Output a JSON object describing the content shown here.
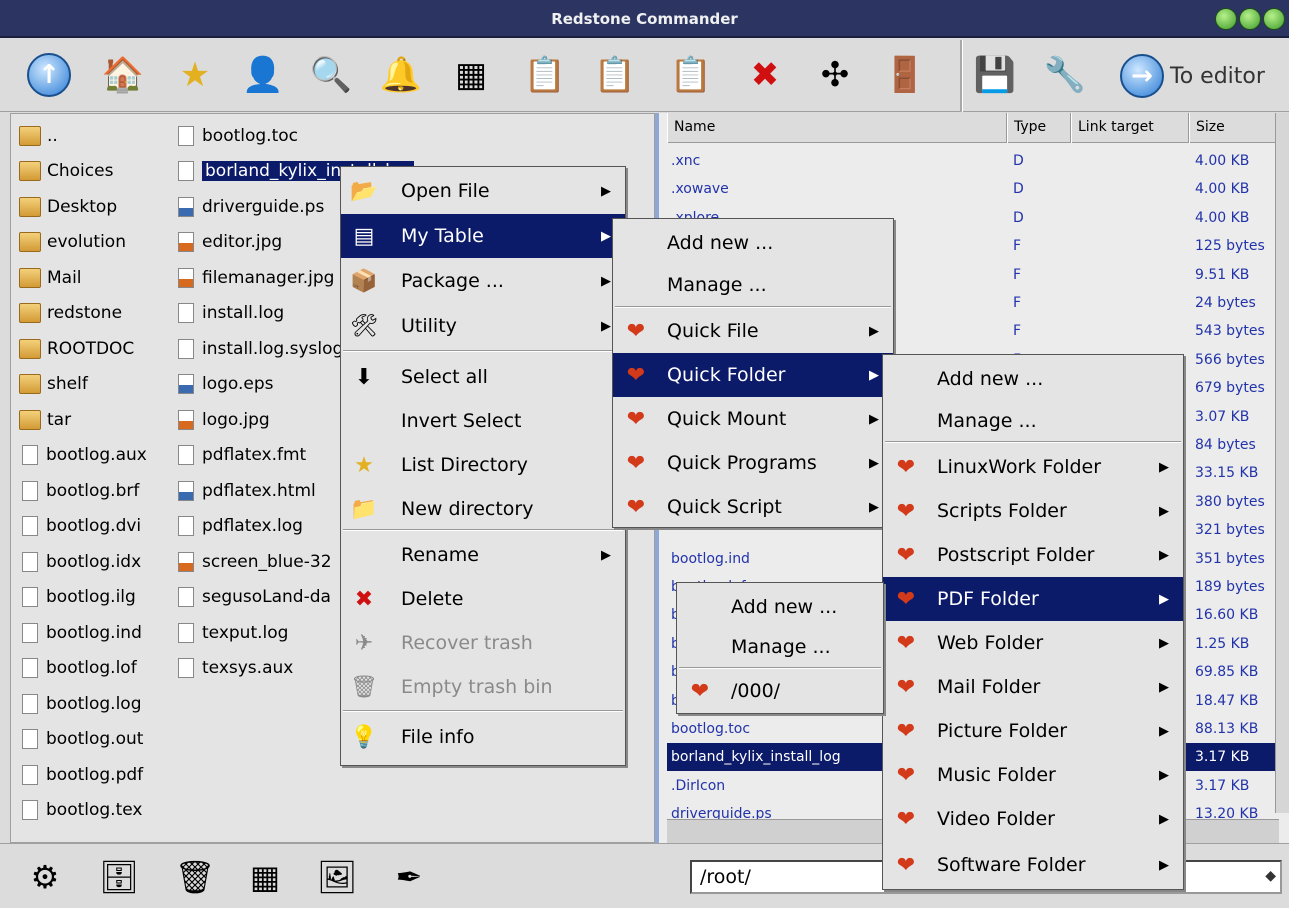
{
  "window": {
    "title": "Redstone Commander"
  },
  "toolbar": {
    "icons": [
      "up-arrow-icon",
      "home-folder-icon",
      "star-icon",
      "contact-card-icon",
      "search-icon",
      "bell-icon",
      "grid-panel-icon",
      "clipboard-icon",
      "clipboard-green-icon",
      "clipboard-up-icon",
      "delete-x-icon",
      "network-arrows-icon",
      "exit-door-icon",
      "drive-icon",
      "tools-icon"
    ],
    "to_editor": "To editor"
  },
  "left_pane": {
    "col1": [
      {
        "name": "..",
        "type": "folder"
      },
      {
        "name": "Choices",
        "type": "folder"
      },
      {
        "name": "Desktop",
        "type": "folder"
      },
      {
        "name": "evolution",
        "type": "folder"
      },
      {
        "name": "Mail",
        "type": "folder"
      },
      {
        "name": "redstone",
        "type": "folder"
      },
      {
        "name": "ROOTDOC",
        "type": "folder"
      },
      {
        "name": "shelf",
        "type": "folder"
      },
      {
        "name": "tar",
        "type": "folder"
      },
      {
        "name": "bootlog.aux",
        "type": "file"
      },
      {
        "name": "bootlog.brf",
        "type": "file"
      },
      {
        "name": "bootlog.dvi",
        "type": "file"
      },
      {
        "name": "bootlog.idx",
        "type": "file"
      },
      {
        "name": "bootlog.ilg",
        "type": "file"
      },
      {
        "name": "bootlog.ind",
        "type": "file"
      },
      {
        "name": "bootlog.lof",
        "type": "file"
      },
      {
        "name": "bootlog.log",
        "type": "file"
      },
      {
        "name": "bootlog.out",
        "type": "file"
      },
      {
        "name": "bootlog.pdf",
        "type": "file"
      },
      {
        "name": "bootlog.tex",
        "type": "file"
      }
    ],
    "col2": [
      {
        "name": "bootlog.toc",
        "type": "file"
      },
      {
        "name": "borland_kylix_install_log",
        "type": "file",
        "selected": true
      },
      {
        "name": "driverguide.ps",
        "type": "ps"
      },
      {
        "name": "editor.jpg",
        "type": "img"
      },
      {
        "name": "filemanager.jpg",
        "type": "img"
      },
      {
        "name": "install.log",
        "type": "file"
      },
      {
        "name": "install.log.syslog",
        "type": "file"
      },
      {
        "name": "logo.eps",
        "type": "ps"
      },
      {
        "name": "logo.jpg",
        "type": "img"
      },
      {
        "name": "pdflatex.fmt",
        "type": "file"
      },
      {
        "name": "pdflatex.html",
        "type": "ps"
      },
      {
        "name": "pdflatex.log",
        "type": "file"
      },
      {
        "name": "screen_blue-32",
        "type": "img"
      },
      {
        "name": "segusoLand-da",
        "type": "file"
      },
      {
        "name": "texput.log",
        "type": "file"
      },
      {
        "name": "texsys.aux",
        "type": "file"
      }
    ]
  },
  "right_pane": {
    "columns": [
      "Name",
      "Type",
      "Link target",
      "Size"
    ],
    "rows": [
      {
        "name": ".xnc",
        "type": "D",
        "link": "",
        "size": "4.00 KB"
      },
      {
        "name": ".xowave",
        "type": "D",
        "link": "",
        "size": "4.00 KB"
      },
      {
        "name": ".xplore",
        "type": "D",
        "link": "",
        "size": "4.00 KB"
      },
      {
        "name": "",
        "type": "F",
        "link": "",
        "size": "125 bytes"
      },
      {
        "name": "",
        "type": "F",
        "link": "",
        "size": "9.51 KB"
      },
      {
        "name": "",
        "type": "F",
        "link": "",
        "size": "24 bytes"
      },
      {
        "name": "",
        "type": "F",
        "link": "",
        "size": "543 bytes"
      },
      {
        "name": "",
        "type": "F",
        "link": "",
        "size": "566 bytes"
      },
      {
        "name": "",
        "type": "",
        "link": "",
        "size": "679 bytes"
      },
      {
        "name": "",
        "type": "",
        "link": "",
        "size": "3.07 KB"
      },
      {
        "name": "",
        "type": "",
        "link": "",
        "size": "84 bytes"
      },
      {
        "name": "",
        "type": "",
        "link": "",
        "size": "33.15 KB"
      },
      {
        "name": "",
        "type": "",
        "link": "",
        "size": "380 bytes"
      },
      {
        "name": "",
        "type": "",
        "link": "",
        "size": "321 bytes"
      },
      {
        "name": "bootlog.ind",
        "type": "",
        "link": "",
        "size": "351 bytes"
      },
      {
        "name": "bootlog.lof",
        "type": "",
        "link": "",
        "size": "189 bytes"
      },
      {
        "name": "b",
        "type": "",
        "link": "",
        "size": "16.60 KB"
      },
      {
        "name": "b",
        "type": "",
        "link": "",
        "size": "1.25 KB"
      },
      {
        "name": "b",
        "type": "",
        "link": "",
        "size": "69.85 KB"
      },
      {
        "name": "b",
        "type": "",
        "link": "",
        "size": "18.47 KB"
      },
      {
        "name": "bootlog.toc",
        "type": "",
        "link": "",
        "size": "88.13 KB"
      },
      {
        "name": "borland_kylix_install_log",
        "type": "",
        "link": "",
        "size": "3.17 KB",
        "selected": true
      },
      {
        "name": ".DirIcon",
        "type": "",
        "link": "",
        "size": "3.17 KB"
      },
      {
        "name": "driverguide.ps",
        "type": "",
        "link": "",
        "size": "13.20 KB"
      }
    ]
  },
  "menu_main": {
    "items": [
      {
        "label": "Open File",
        "icon": "open-file-icon",
        "arrow": true
      },
      {
        "label": "My Table",
        "icon": "table-icon",
        "arrow": true,
        "highlight": true
      },
      {
        "label": "Package ...",
        "icon": "package-icon",
        "arrow": true
      },
      {
        "label": "Utility",
        "icon": "utility-icon",
        "arrow": true
      },
      {
        "label": "Select all",
        "icon": "select-all-icon"
      },
      {
        "label": "Invert Select",
        "icon": ""
      },
      {
        "label": "List Directory",
        "icon": "star-icon"
      },
      {
        "label": "New directory",
        "icon": "folder-icon"
      },
      {
        "label": "Rename",
        "icon": "",
        "arrow": true
      },
      {
        "label": "Delete",
        "icon": "delete-icon"
      },
      {
        "label": "Recover trash",
        "icon": "recover-icon",
        "dim": true
      },
      {
        "label": "Empty trash bin",
        "icon": "trash-icon",
        "dim": true
      },
      {
        "label": "File info",
        "icon": "lightbulb-icon"
      }
    ]
  },
  "menu_table": {
    "items": [
      {
        "label": "Add new ..."
      },
      {
        "label": "Manage ..."
      },
      {
        "label": "Quick File",
        "arrow": true
      },
      {
        "label": "Quick Folder",
        "arrow": true,
        "highlight": true
      },
      {
        "label": "Quick Mount",
        "arrow": true
      },
      {
        "label": "Quick Programs",
        "arrow": true
      },
      {
        "label": "Quick Script",
        "arrow": true
      }
    ]
  },
  "menu_folder": {
    "items": [
      {
        "label": "Add new ..."
      },
      {
        "label": "Manage ..."
      },
      {
        "label": "LinuxWork Folder",
        "arrow": true
      },
      {
        "label": "Scripts Folder",
        "arrow": true
      },
      {
        "label": "Postscript Folder",
        "arrow": true
      },
      {
        "label": "PDF Folder",
        "arrow": true,
        "highlight": true
      },
      {
        "label": "Web Folder",
        "arrow": true
      },
      {
        "label": "Mail Folder",
        "arrow": true
      },
      {
        "label": "Picture Folder",
        "arrow": true
      },
      {
        "label": "Music Folder",
        "arrow": true
      },
      {
        "label": "Video Folder",
        "arrow": true
      },
      {
        "label": "Software Folder",
        "arrow": true
      }
    ]
  },
  "menu_pdf": {
    "items": [
      {
        "label": "Add new ..."
      },
      {
        "label": "Manage ..."
      },
      {
        "label": "/000/"
      }
    ]
  },
  "bottom": {
    "icons": [
      "settings-gear-icon",
      "file-cabinet-icon",
      "trash-can-icon",
      "grid-panel-icon",
      "images-icon",
      "quill-pen-icon"
    ],
    "path": "/root/"
  },
  "colors": {
    "selection": "#0c1a6a",
    "titlebar": "#2c3562"
  }
}
